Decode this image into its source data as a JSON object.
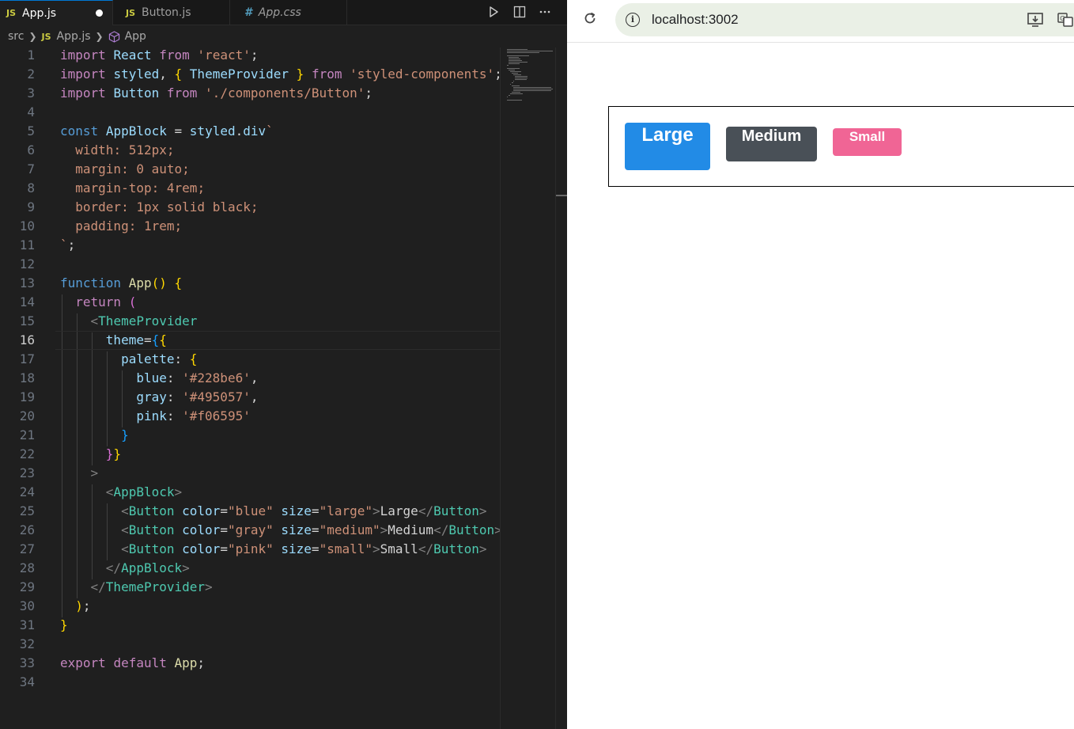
{
  "editor": {
    "tabs": [
      {
        "icon": "JS",
        "label": "App.js",
        "modified": true,
        "active": true
      },
      {
        "icon": "JS",
        "label": "Button.js",
        "modified": false,
        "active": false
      },
      {
        "icon": "#",
        "label": "App.css",
        "modified": false,
        "active": false
      }
    ],
    "breadcrumb": {
      "folder": "src",
      "file_icon": "JS",
      "file": "App.js",
      "symbol": "App"
    },
    "toolbar_icons": [
      "run-icon",
      "split-editor-icon",
      "more-actions-icon"
    ],
    "current_line": 16,
    "line_numbers": [
      "1",
      "2",
      "3",
      "4",
      "5",
      "6",
      "7",
      "8",
      "9",
      "10",
      "11",
      "12",
      "13",
      "14",
      "15",
      "16",
      "17",
      "18",
      "19",
      "20",
      "21",
      "22",
      "23",
      "24",
      "25",
      "26",
      "27",
      "28",
      "29",
      "30",
      "31",
      "32",
      "33",
      "34"
    ],
    "lines": [
      "import React from 'react';",
      "import styled, { ThemeProvider } from 'styled-components';",
      "import Button from './components/Button';",
      "",
      "const AppBlock = styled.div`",
      "  width: 512px;",
      "  margin: 0 auto;",
      "  margin-top: 4rem;",
      "  border: 1px solid black;",
      "  padding: 1rem;",
      "`;",
      "",
      "function App() {",
      "  return (",
      "    <ThemeProvider",
      "      theme={{",
      "        palette: {",
      "          blue: '#228be6',",
      "          gray: '#495057',",
      "          pink: '#f06595'",
      "        }",
      "      }}",
      "    >",
      "      <AppBlock>",
      "        <Button color=\"blue\" size=\"large\">Large</Button>",
      "        <Button color=\"gray\" size=\"medium\">Medium</Button>",
      "        <Button color=\"pink\" size=\"small\">Small</Button>",
      "      </AppBlock>",
      "    </ThemeProvider>",
      "  );",
      "}",
      "",
      "export default App;",
      ""
    ]
  },
  "browser": {
    "url": "localhost:3002",
    "buttons": [
      {
        "label": "Large",
        "size": "large",
        "color": "#228be6"
      },
      {
        "label": "Medium",
        "size": "medium",
        "color": "#495057"
      },
      {
        "label": "Small",
        "size": "small",
        "color": "#f06595"
      }
    ],
    "toolbar_icons": [
      "reload-icon",
      "site-info-icon",
      "install-app-icon",
      "translate-icon"
    ]
  }
}
